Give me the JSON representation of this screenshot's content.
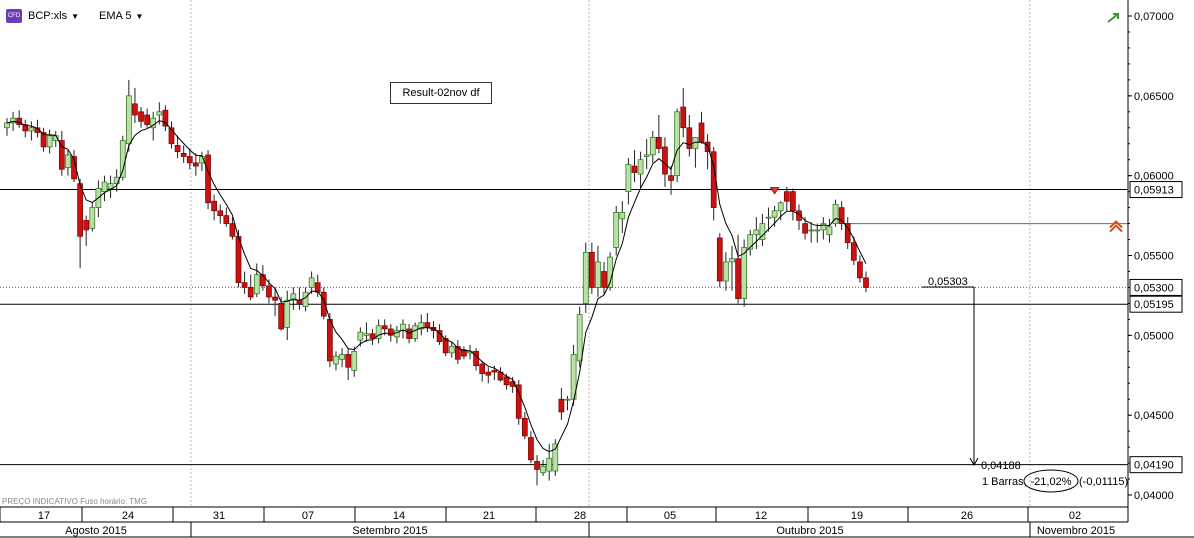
{
  "toolbar": {
    "instrument_badge": "CFD",
    "instrument": "BCP:xls",
    "indicator": "EMA 5"
  },
  "annotation_box": "Result-02nov df",
  "footer_note": "PREÇO INDICATIVO  Fuso horário: TMG",
  "colors": {
    "up": "#b9e0a5",
    "up_border": "#2a6e1a",
    "down": "#cc1111",
    "ema": "#000000",
    "hline": "#000000",
    "green_line": "#2c9b2c",
    "dotted_line": "#cc3333"
  },
  "chart_data": {
    "type": "candlestick",
    "ylim": [
      0.0395,
      0.0712
    ],
    "price_ticks": [
      "0,07000",
      "0,06500",
      "0,06000",
      "0,05500",
      "0,05000",
      "0,04500",
      "0,04000"
    ],
    "price_tick_values": [
      0.07,
      0.065,
      0.06,
      0.055,
      0.05,
      0.045,
      0.04
    ],
    "x_day_labels": [
      "17",
      "24",
      "31",
      "07",
      "14",
      "21",
      "28",
      "05",
      "12",
      "19",
      "26",
      "02"
    ],
    "x_month_labels": [
      "Agosto 2015",
      "Setembro 2015",
      "Outubro 2015",
      "Novembro 2015"
    ],
    "horizontal_lines": [
      {
        "value": 0.05913,
        "label": "0,05913"
      },
      {
        "value": 0.05195,
        "label": "0,05195"
      },
      {
        "value": 0.0419,
        "label": "0,04190"
      }
    ],
    "current_price": {
      "value": 0.053,
      "label": "0,05300"
    },
    "green_line_value": 0.057,
    "measure": {
      "start_label": "0,05303",
      "end_label": "0,04188",
      "summary_prefix": "1 Barras,",
      "summary_pct": "-21,02%",
      "summary_abs": "(-0,01115)"
    },
    "ema_period": 5,
    "candles": [
      [
        0.063,
        0.0636,
        0.0625,
        0.0633
      ],
      [
        0.0633,
        0.064,
        0.0628,
        0.0636
      ],
      [
        0.0636,
        0.0641,
        0.063,
        0.0632
      ],
      [
        0.0632,
        0.0635,
        0.0624,
        0.0628
      ],
      [
        0.0628,
        0.0634,
        0.0622,
        0.063
      ],
      [
        0.063,
        0.0635,
        0.0624,
        0.0627
      ],
      [
        0.0627,
        0.063,
        0.0615,
        0.0618
      ],
      [
        0.0618,
        0.0629,
        0.0614,
        0.0625
      ],
      [
        0.0622,
        0.0628,
        0.0618,
        0.0625
      ],
      [
        0.0622,
        0.0628,
        0.06,
        0.0604
      ],
      [
        0.0605,
        0.0616,
        0.06,
        0.0613
      ],
      [
        0.0612,
        0.0616,
        0.0596,
        0.0598
      ],
      [
        0.0595,
        0.0598,
        0.0542,
        0.0562
      ],
      [
        0.0572,
        0.0575,
        0.0556,
        0.0566
      ],
      [
        0.0567,
        0.0583,
        0.0565,
        0.058
      ],
      [
        0.058,
        0.0597,
        0.0574,
        0.0592
      ],
      [
        0.059,
        0.06,
        0.0584,
        0.0596
      ],
      [
        0.0592,
        0.06,
        0.0586,
        0.0595
      ],
      [
        0.0595,
        0.0604,
        0.059,
        0.0599
      ],
      [
        0.0599,
        0.0625,
        0.0597,
        0.0622
      ],
      [
        0.062,
        0.066,
        0.0615,
        0.065
      ],
      [
        0.0645,
        0.0655,
        0.0633,
        0.0638
      ],
      [
        0.064,
        0.0643,
        0.063,
        0.0634
      ],
      [
        0.0638,
        0.0642,
        0.063,
        0.0632
      ],
      [
        0.063,
        0.064,
        0.0622,
        0.0636
      ],
      [
        0.0638,
        0.0646,
        0.0632,
        0.064
      ],
      [
        0.0641,
        0.0644,
        0.0628,
        0.0631
      ],
      [
        0.063,
        0.0634,
        0.0617,
        0.062
      ],
      [
        0.0619,
        0.0625,
        0.0611,
        0.0615
      ],
      [
        0.0614,
        0.0619,
        0.0608,
        0.0612
      ],
      [
        0.0612,
        0.0617,
        0.0604,
        0.0608
      ],
      [
        0.0608,
        0.0614,
        0.06,
        0.0606
      ],
      [
        0.0608,
        0.0615,
        0.0603,
        0.0612
      ],
      [
        0.0613,
        0.0616,
        0.0579,
        0.0583
      ],
      [
        0.0584,
        0.0588,
        0.0572,
        0.0578
      ],
      [
        0.0578,
        0.0582,
        0.057,
        0.0575
      ],
      [
        0.0575,
        0.058,
        0.0568,
        0.057
      ],
      [
        0.057,
        0.0574,
        0.056,
        0.0562
      ],
      [
        0.0562,
        0.0566,
        0.053,
        0.0533
      ],
      [
        0.0533,
        0.054,
        0.0526,
        0.053
      ],
      [
        0.053,
        0.0538,
        0.0522,
        0.0524
      ],
      [
        0.0526,
        0.0545,
        0.0524,
        0.0538
      ],
      [
        0.0538,
        0.0544,
        0.0528,
        0.0531
      ],
      [
        0.0531,
        0.0535,
        0.052,
        0.0524
      ],
      [
        0.0524,
        0.053,
        0.0512,
        0.0522
      ],
      [
        0.052,
        0.0524,
        0.0503,
        0.0504
      ],
      [
        0.0505,
        0.0528,
        0.0497,
        0.0522
      ],
      [
        0.0522,
        0.053,
        0.0516,
        0.0526
      ],
      [
        0.0522,
        0.053,
        0.0516,
        0.052
      ],
      [
        0.0518,
        0.053,
        0.0515,
        0.0527
      ],
      [
        0.053,
        0.054,
        0.0526,
        0.0536
      ],
      [
        0.0533,
        0.0538,
        0.0524,
        0.0527
      ],
      [
        0.0527,
        0.053,
        0.051,
        0.0512
      ],
      [
        0.051,
        0.0514,
        0.048,
        0.0484
      ],
      [
        0.0482,
        0.049,
        0.0478,
        0.0487
      ],
      [
        0.0485,
        0.0492,
        0.048,
        0.0488
      ],
      [
        0.0488,
        0.0492,
        0.0472,
        0.048
      ],
      [
        0.0478,
        0.0493,
        0.0474,
        0.049
      ],
      [
        0.0497,
        0.0505,
        0.0493,
        0.0502
      ],
      [
        0.05,
        0.0508,
        0.0496,
        0.0501
      ],
      [
        0.0501,
        0.0504,
        0.0494,
        0.0498
      ],
      [
        0.0498,
        0.051,
        0.0495,
        0.0506
      ],
      [
        0.0506,
        0.051,
        0.05,
        0.0504
      ],
      [
        0.0504,
        0.0507,
        0.0496,
        0.05
      ],
      [
        0.0499,
        0.0506,
        0.0495,
        0.0503
      ],
      [
        0.0503,
        0.051,
        0.0498,
        0.0507
      ],
      [
        0.0504,
        0.0507,
        0.0495,
        0.0498
      ],
      [
        0.0498,
        0.0508,
        0.0496,
        0.0506
      ],
      [
        0.0504,
        0.0513,
        0.05,
        0.0508
      ],
      [
        0.0508,
        0.0514,
        0.0502,
        0.0505
      ],
      [
        0.0505,
        0.0509,
        0.0498,
        0.0503
      ],
      [
        0.0503,
        0.0507,
        0.0494,
        0.0496
      ],
      [
        0.0498,
        0.05,
        0.0487,
        0.0489
      ],
      [
        0.0489,
        0.0496,
        0.0486,
        0.0493
      ],
      [
        0.0493,
        0.0497,
        0.0482,
        0.0485
      ],
      [
        0.0491,
        0.0493,
        0.0485,
        0.0487
      ],
      [
        0.0489,
        0.0494,
        0.0485,
        0.049
      ],
      [
        0.049,
        0.0492,
        0.0478,
        0.0481
      ],
      [
        0.0482,
        0.0484,
        0.0471,
        0.0476
      ],
      [
        0.0477,
        0.048,
        0.047,
        0.0475
      ],
      [
        0.0478,
        0.0481,
        0.0472,
        0.0477
      ],
      [
        0.0477,
        0.048,
        0.0471,
        0.0472
      ],
      [
        0.0474,
        0.0476,
        0.0466,
        0.0469
      ],
      [
        0.0471,
        0.0474,
        0.0464,
        0.0468
      ],
      [
        0.0469,
        0.0472,
        0.0444,
        0.0448
      ],
      [
        0.0448,
        0.0452,
        0.0435,
        0.0437
      ],
      [
        0.0436,
        0.044,
        0.042,
        0.0422
      ],
      [
        0.0421,
        0.0425,
        0.0406,
        0.0416
      ],
      [
        0.0414,
        0.0422,
        0.0412,
        0.0418
      ],
      [
        0.0415,
        0.0432,
        0.0409,
        0.0423
      ],
      [
        0.0415,
        0.0435,
        0.0412,
        0.0432
      ],
      [
        0.046,
        0.0467,
        0.0447,
        0.0452
      ],
      [
        0.046,
        0.0462,
        0.0453,
        0.046
      ],
      [
        0.046,
        0.0494,
        0.0456,
        0.0488
      ],
      [
        0.0484,
        0.0518,
        0.048,
        0.0513
      ],
      [
        0.052,
        0.0558,
        0.0514,
        0.0552
      ],
      [
        0.0552,
        0.0558,
        0.0526,
        0.053
      ],
      [
        0.053,
        0.0556,
        0.0524,
        0.0546
      ],
      [
        0.054,
        0.0546,
        0.0526,
        0.053
      ],
      [
        0.053,
        0.0552,
        0.0528,
        0.0549
      ],
      [
        0.0555,
        0.0581,
        0.055,
        0.0577
      ],
      [
        0.0573,
        0.0584,
        0.0564,
        0.0577
      ],
      [
        0.059,
        0.0611,
        0.0582,
        0.0607
      ],
      [
        0.0606,
        0.0616,
        0.0596,
        0.0602
      ],
      [
        0.0601,
        0.0615,
        0.0592,
        0.061
      ],
      [
        0.0612,
        0.0623,
        0.0604,
        0.0613
      ],
      [
        0.0613,
        0.0628,
        0.0608,
        0.0624
      ],
      [
        0.0624,
        0.0638,
        0.0614,
        0.0617
      ],
      [
        0.0618,
        0.0624,
        0.0593,
        0.0601
      ],
      [
        0.06,
        0.0606,
        0.0588,
        0.0597
      ],
      [
        0.06,
        0.0642,
        0.0596,
        0.064
      ],
      [
        0.0643,
        0.0655,
        0.0624,
        0.063
      ],
      [
        0.063,
        0.0638,
        0.0612,
        0.0617
      ],
      [
        0.0617,
        0.0624,
        0.0605,
        0.0624
      ],
      [
        0.0633,
        0.064,
        0.062,
        0.0621
      ],
      [
        0.0621,
        0.0626,
        0.0604,
        0.0615
      ],
      [
        0.0615,
        0.0618,
        0.0572,
        0.058
      ],
      [
        0.0561,
        0.0564,
        0.053,
        0.0534
      ],
      [
        0.0534,
        0.0552,
        0.0528,
        0.0546
      ],
      [
        0.0546,
        0.0556,
        0.0528,
        0.0548
      ],
      [
        0.0548,
        0.0563,
        0.052,
        0.0523
      ],
      [
        0.0523,
        0.056,
        0.0518,
        0.0555
      ],
      [
        0.0554,
        0.0566,
        0.055,
        0.0563
      ],
      [
        0.0563,
        0.0574,
        0.0554,
        0.0566
      ],
      [
        0.056,
        0.0576,
        0.0556,
        0.057
      ],
      [
        0.0574,
        0.058,
        0.0565,
        0.0574
      ],
      [
        0.0574,
        0.0581,
        0.0568,
        0.0578
      ],
      [
        0.0578,
        0.0584,
        0.0572,
        0.0583
      ],
      [
        0.059,
        0.0593,
        0.0578,
        0.0584
      ],
      [
        0.059,
        0.0592,
        0.0572,
        0.0578
      ],
      [
        0.0578,
        0.0582,
        0.0566,
        0.0572
      ],
      [
        0.057,
        0.0574,
        0.056,
        0.0564
      ],
      [
        0.0566,
        0.0571,
        0.0558,
        0.0566
      ],
      [
        0.0566,
        0.057,
        0.0558,
        0.0566
      ],
      [
        0.0566,
        0.0574,
        0.056,
        0.057
      ],
      [
        0.0563,
        0.0573,
        0.0558,
        0.0568
      ],
      [
        0.057,
        0.0585,
        0.0568,
        0.0582
      ],
      [
        0.058,
        0.0584,
        0.0566,
        0.057
      ],
      [
        0.057,
        0.0574,
        0.0554,
        0.0558
      ],
      [
        0.0558,
        0.0562,
        0.0544,
        0.0547
      ],
      [
        0.0546,
        0.055,
        0.0533,
        0.0536
      ],
      [
        0.0536,
        0.054,
        0.0527,
        0.053
      ]
    ]
  }
}
